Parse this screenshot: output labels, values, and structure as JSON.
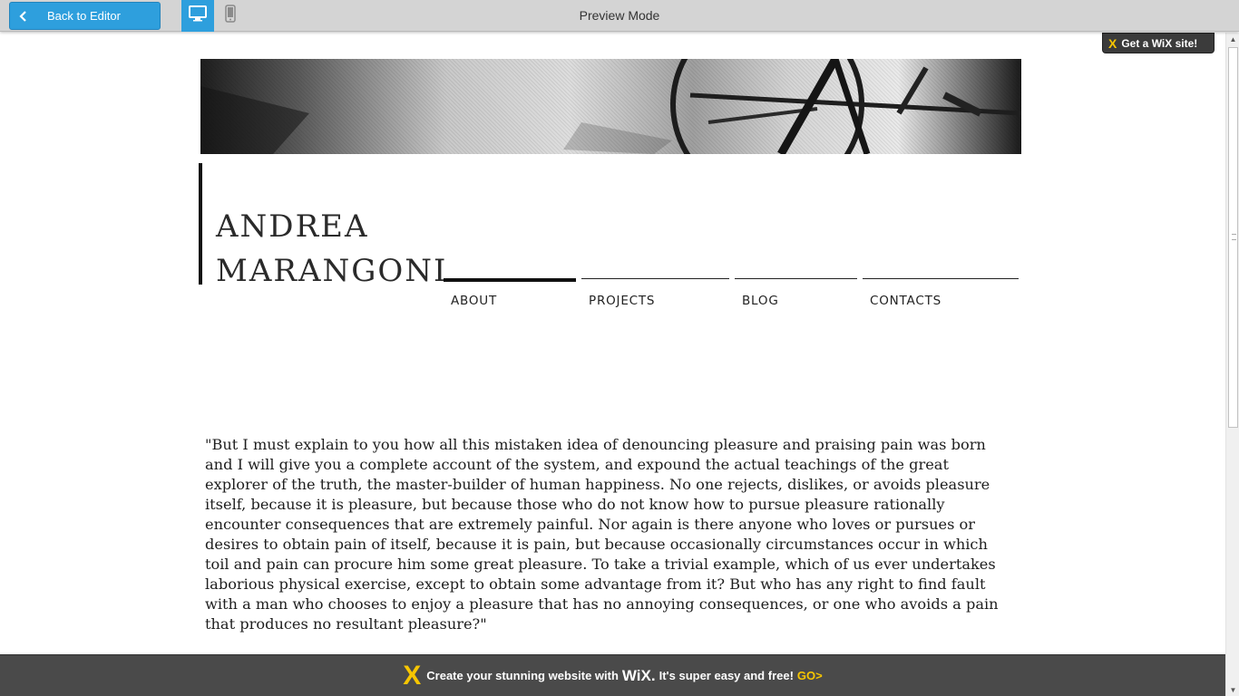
{
  "toolbar": {
    "back_label": "Back to Editor",
    "title": "Preview Mode",
    "devices": [
      {
        "name": "desktop-icon",
        "active": true
      },
      {
        "name": "mobile-icon",
        "active": false
      }
    ]
  },
  "badge": {
    "label": "Get a WiX site!"
  },
  "site": {
    "title_line1": "ANDREA",
    "title_line2": "MARANGONI",
    "nav": [
      {
        "label": "ABOUT",
        "active": true
      },
      {
        "label": "PROJECTS",
        "active": false
      },
      {
        "label": "BLOG",
        "active": false
      },
      {
        "label": "CONTACTS",
        "active": false
      }
    ],
    "quote": "\"But I must explain to you how all this mistaken idea of denouncing pleasure and praising pain was born and I will give you a complete account of the system, and expound the actual teachings of the great explorer of the truth, the master-builder of human happiness. No one rejects, dislikes, or avoids pleasure itself, because it is pleasure, but because those who do not know how to pursue pleasure rationally encounter consequences that are extremely painful. Nor again is there anyone who loves or pursues or desires to obtain pain of itself, because it is pain, but because occasionally circumstances occur in which toil and pain can procure him some great pleasure. To take a trivial example, which of us ever undertakes laborious physical exercise, except to obtain some advantage from it? But who has any right to find fault with a man who chooses to enjoy a pleasure that has no annoying consequences, or one who avoids a pain that produces no resultant pleasure?\""
  },
  "promo": {
    "text_before": "Create your stunning website with",
    "brand": "WiX.",
    "text_after": "It's super easy and free!",
    "go": "GO>"
  },
  "colors": {
    "accent": "#2e9fdd",
    "toolbar_bg": "#d4d4d4",
    "promo_bg": "#4a4a4a",
    "wix_yellow": "#f7c600"
  }
}
